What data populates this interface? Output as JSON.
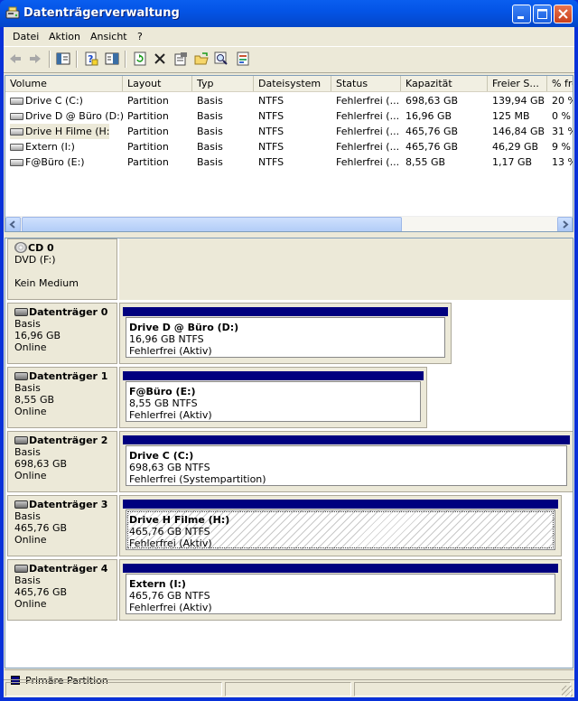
{
  "window": {
    "title": "Datenträgerverwaltung"
  },
  "menu": [
    "Datei",
    "Aktion",
    "Ansicht",
    "?"
  ],
  "toolbar": {
    "icons": [
      "back-arrow-icon",
      "forward-arrow-icon",
      "console-tree-icon",
      "help-icon",
      "properties-pane-icon",
      "refresh-icon",
      "delete-icon",
      "properties-icon",
      "open-icon",
      "search-icon",
      "export-icon"
    ]
  },
  "volumes": {
    "columns": [
      "Volume",
      "Layout",
      "Typ",
      "Dateisystem",
      "Status",
      "Kapazität",
      "Freier S...",
      "% frei"
    ],
    "rows": [
      [
        "Drive C (C:)",
        "Partition",
        "Basis",
        "NTFS",
        "Fehlerfrei (...",
        "698,63 GB",
        "139,94 GB",
        "20 %"
      ],
      [
        "Drive D @ Büro (D:)",
        "Partition",
        "Basis",
        "NTFS",
        "Fehlerfrei (...",
        "16,96 GB",
        "125 MB",
        "0 %"
      ],
      [
        "Drive H Filme (H:)",
        "Partition",
        "Basis",
        "NTFS",
        "Fehlerfrei (...",
        "465,76 GB",
        "146,84 GB",
        "31 %"
      ],
      [
        "Extern (I:)",
        "Partition",
        "Basis",
        "NTFS",
        "Fehlerfrei (...",
        "465,76 GB",
        "46,29 GB",
        "9 %"
      ],
      [
        "F@Büro (E:)",
        "Partition",
        "Basis",
        "NTFS",
        "Fehlerfrei (...",
        "8,55 GB",
        "1,17 GB",
        "13 %"
      ]
    ],
    "selected_row": 2
  },
  "disks": [
    {
      "name": "CD 0",
      "line1": "DVD (F:)",
      "line2": "",
      "line3": "Kein Medium",
      "partition": null
    },
    {
      "name": "Datenträger 0",
      "line1": "Basis",
      "line2": "16,96 GB",
      "line3": "Online",
      "partition": {
        "name": "Drive D @ Büro  (D:)",
        "size": "16,96 GB NTFS",
        "status": "Fehlerfrei (Aktiv)"
      }
    },
    {
      "name": "Datenträger 1",
      "line1": "Basis",
      "line2": "8,55 GB",
      "line3": "Online",
      "partition": {
        "name": "F@Büro  (E:)",
        "size": "8,55 GB NTFS",
        "status": "Fehlerfrei (Aktiv)"
      }
    },
    {
      "name": "Datenträger 2",
      "line1": "Basis",
      "line2": "698,63 GB",
      "line3": "Online",
      "partition": {
        "name": "Drive C  (C:)",
        "size": "698,63 GB NTFS",
        "status": "Fehlerfrei (Systempartition)"
      }
    },
    {
      "name": "Datenträger 3",
      "line1": "Basis",
      "line2": "465,76 GB",
      "line3": "Online",
      "partition": {
        "name": "Drive H Filme  (H:)",
        "size": "465,76 GB NTFS",
        "status": "Fehlerfrei (Aktiv)",
        "selected": true
      }
    },
    {
      "name": "Datenträger 4",
      "line1": "Basis",
      "line2": "465,76 GB",
      "line3": "Online",
      "partition": {
        "name": "Extern  (I:)",
        "size": "465,76 GB NTFS",
        "status": "Fehlerfrei (Aktiv)"
      }
    }
  ],
  "legend": {
    "label": "Primäre Partition",
    "color": "#00007f"
  }
}
